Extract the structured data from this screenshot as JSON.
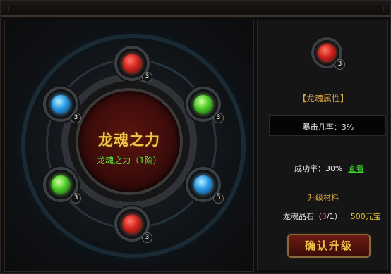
{
  "core": {
    "title": "龙魂之力",
    "subtitle": "龙魂之力（1阶）"
  },
  "slots": [
    {
      "gem": "red",
      "level": "3"
    },
    {
      "gem": "green",
      "level": "3"
    },
    {
      "gem": "blue",
      "level": "3"
    },
    {
      "gem": "red",
      "level": "3"
    },
    {
      "gem": "green",
      "level": "3"
    },
    {
      "gem": "blue",
      "level": "3"
    }
  ],
  "preview": {
    "gem": "red",
    "level": "3"
  },
  "attributes": {
    "header": "【龙魂属性】",
    "crit": "暴击几率：3%",
    "success_rate": "成功率：30%",
    "view_link": "查看"
  },
  "materials": {
    "header": "升级材料",
    "item_name": "龙魂晶石（",
    "item_count": "0",
    "item_total": "/1）",
    "price": "500元宝"
  },
  "confirm_button": "确认升级",
  "colors": {
    "gold": "#f2c24b",
    "green": "#5fe23b",
    "red": "#e23b2b",
    "yellow": "#e0c23a"
  }
}
